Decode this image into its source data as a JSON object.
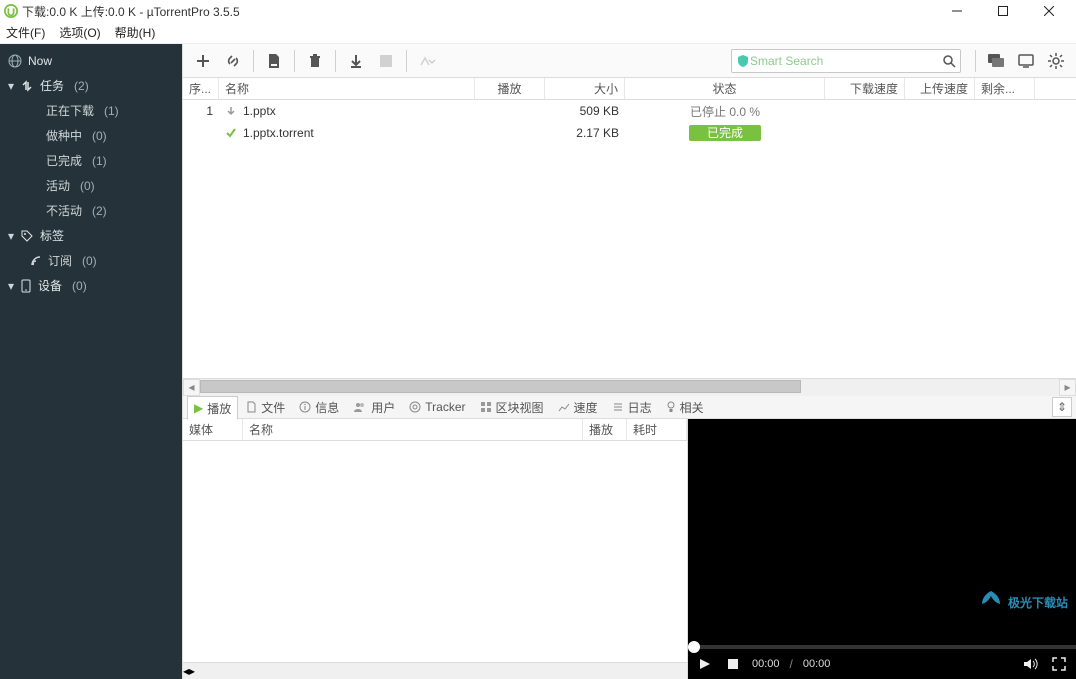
{
  "title": "下载:0.0 K 上传:0.0 K - µTorrentPro 3.5.5",
  "menu": {
    "file": "文件(F)",
    "options": "选项(O)",
    "help": "帮助(H)"
  },
  "sidebar": {
    "now": "Now",
    "tasks": {
      "label": "任务",
      "count": "(2)"
    },
    "downloading": {
      "label": "正在下载",
      "count": "(1)"
    },
    "seeding": {
      "label": "做种中",
      "count": "(0)"
    },
    "completed": {
      "label": "已完成",
      "count": "(1)"
    },
    "active": {
      "label": "活动",
      "count": "(0)"
    },
    "inactive": {
      "label": "不活动",
      "count": "(2)"
    },
    "labels": "标签",
    "feeds": {
      "label": "订阅",
      "count": "(0)"
    },
    "devices": {
      "label": "设备",
      "count": "(0)"
    }
  },
  "search": {
    "placeholder": "Smart Search"
  },
  "columns": {
    "seq": "序...",
    "name": "名称",
    "play": "播放",
    "size": "大小",
    "status": "状态",
    "dlspeed": "下载速度",
    "ulspeed": "上传速度",
    "eta": "剩余..."
  },
  "torrents": [
    {
      "seq": "1",
      "name": "1.pptx",
      "size": "509 KB",
      "status_text": "已停止 0.0 %",
      "status_kind": "stopped"
    },
    {
      "seq": "",
      "name": "1.pptx.torrent",
      "size": "2.17 KB",
      "status_text": "已完成",
      "status_kind": "done"
    }
  ],
  "tabs": {
    "play": "播放",
    "files": "文件",
    "info": "信息",
    "peers": "用户",
    "tracker": "Tracker",
    "pieces": "区块视图",
    "speed": "速度",
    "log": "日志",
    "related": "相关"
  },
  "lower_cols": {
    "media": "媒体",
    "name": "名称",
    "play": "播放",
    "duration": "耗时"
  },
  "player": {
    "cur": "00:00",
    "total": "00:00"
  },
  "watermark": {
    "brand": "极光下载站"
  }
}
